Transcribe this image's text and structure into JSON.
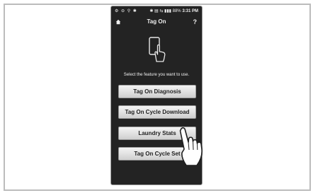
{
  "status_bar": {
    "left_icons": "⚙ ⊖ ⚲ ✱",
    "right_icons": "✱ ▤ ⇆ ▮▮▮ 88%",
    "time": "3:31 PM"
  },
  "app_bar": {
    "home_icon": "home-icon",
    "title": "Tag On",
    "help": "?"
  },
  "prompt": "Select the feature you want to use.",
  "menu": [
    {
      "label": "Tag On Diagnosis"
    },
    {
      "label": "Tag On Cycle Download"
    },
    {
      "label": "Laundry Stats"
    },
    {
      "label": "Tag On Cycle Set"
    }
  ],
  "colors": {
    "screen_bg": "#232323",
    "button_top": "#f4f4f4",
    "button_bottom": "#cfcfcf",
    "text_dark": "#1f1f1f"
  }
}
